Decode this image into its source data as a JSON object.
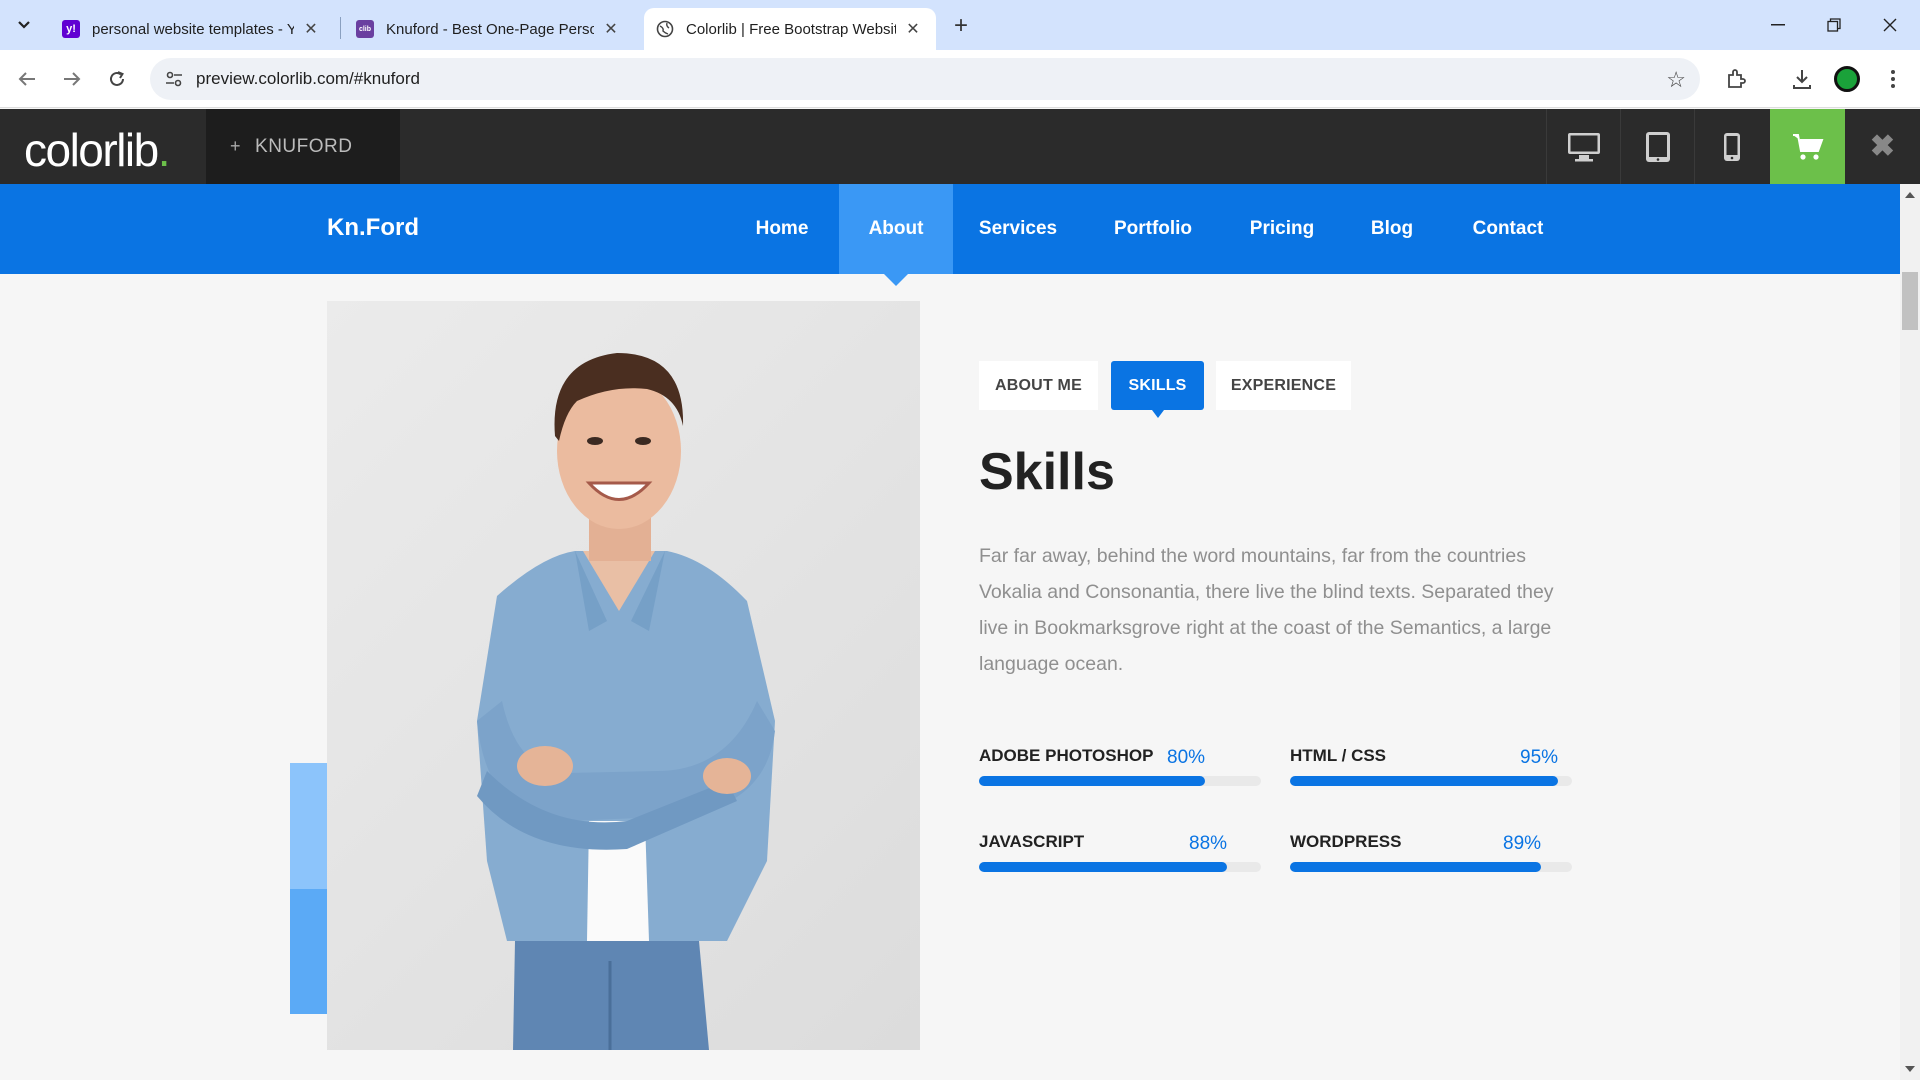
{
  "browser": {
    "tabs": [
      {
        "title": "personal website templates - Ya",
        "favicon": "yahoo-icon",
        "active": false
      },
      {
        "title": "Knuford - Best One-Page Perso",
        "favicon": "colorlib-icon",
        "active": false
      },
      {
        "title": "Colorlib | Free Bootstrap Websit",
        "favicon": "globe-icon",
        "active": true
      }
    ],
    "url": "preview.colorlib.com/#knuford"
  },
  "colorlib_bar": {
    "logo": "colorlib",
    "logo_dot": ".",
    "theme_name": "KNUFORD",
    "plus": "+"
  },
  "site": {
    "brand": "Kn.Ford",
    "nav": [
      "Home",
      "About",
      "Services",
      "Portfolio",
      "Pricing",
      "Blog",
      "Contact"
    ],
    "active_nav": "About"
  },
  "about": {
    "tabs": [
      "ABOUT ME",
      "SKILLS",
      "EXPERIENCE"
    ],
    "active_tab": "SKILLS",
    "heading": "Skills",
    "paragraph": "Far far away, behind the word mountains, far from the countries Vokalia and Consonantia, there live the blind texts. Separated they live in Bookmarksgrove right at the coast of the Semantics, a large language ocean.",
    "skills": [
      {
        "name": "ADOBE PHOTOSHOP",
        "percent_label": "80%",
        "value": 0.8
      },
      {
        "name": "HTML / CSS",
        "percent_label": "95%",
        "value": 0.95
      },
      {
        "name": "JAVASCRIPT",
        "percent_label": "88%",
        "value": 0.88
      },
      {
        "name": "WORDPRESS",
        "percent_label": "89%",
        "value": 0.89
      }
    ]
  },
  "colors": {
    "primary": "#0a74e3",
    "nav_active": "#3a98f5",
    "colorlib_green": "#6cc04a",
    "colorlib_bar": "#2b2b2b"
  }
}
